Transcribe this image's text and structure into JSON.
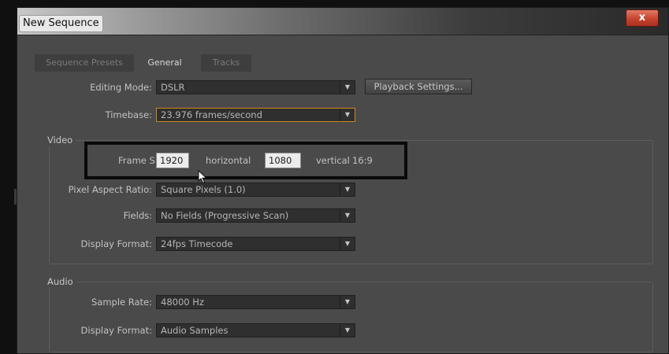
{
  "window": {
    "title": "New Sequence",
    "close_glyph": "x"
  },
  "tabs": [
    {
      "label": "Sequence Presets",
      "active": false
    },
    {
      "label": "General",
      "active": true
    },
    {
      "label": "Tracks",
      "active": false
    }
  ],
  "general": {
    "editing_mode": {
      "label": "Editing Mode:",
      "value": "DSLR"
    },
    "playback_button": "Playback Settings...",
    "timebase": {
      "label": "Timebase:",
      "value": "23.976 frames/second"
    }
  },
  "video": {
    "title": "Video",
    "frame_size": {
      "label": "Frame Size:",
      "horizontal_value": "1920",
      "horizontal_label": "horizontal",
      "vertical_value": "1080",
      "vertical_label": "vertical",
      "aspect": "16:9"
    },
    "pixel_aspect": {
      "label": "Pixel Aspect Ratio:",
      "value": "Square Pixels (1.0)"
    },
    "fields": {
      "label": "Fields:",
      "value": "No Fields (Progressive Scan)"
    },
    "display_format": {
      "label": "Display Format:",
      "value": "24fps Timecode"
    }
  },
  "audio": {
    "title": "Audio",
    "sample_rate": {
      "label": "Sample Rate:",
      "value": "48000 Hz"
    },
    "display_format": {
      "label": "Display Format:",
      "value": "Audio Samples"
    }
  },
  "icons": {
    "dropdown_arrow": "▼",
    "cursor": "mouse-pointer-icon"
  },
  "colors": {
    "dialog_bg": "#4a4a4a",
    "field_bg": "#2f2f2f",
    "focus_border": "#c88a1a",
    "close_button": "#c5442f"
  }
}
